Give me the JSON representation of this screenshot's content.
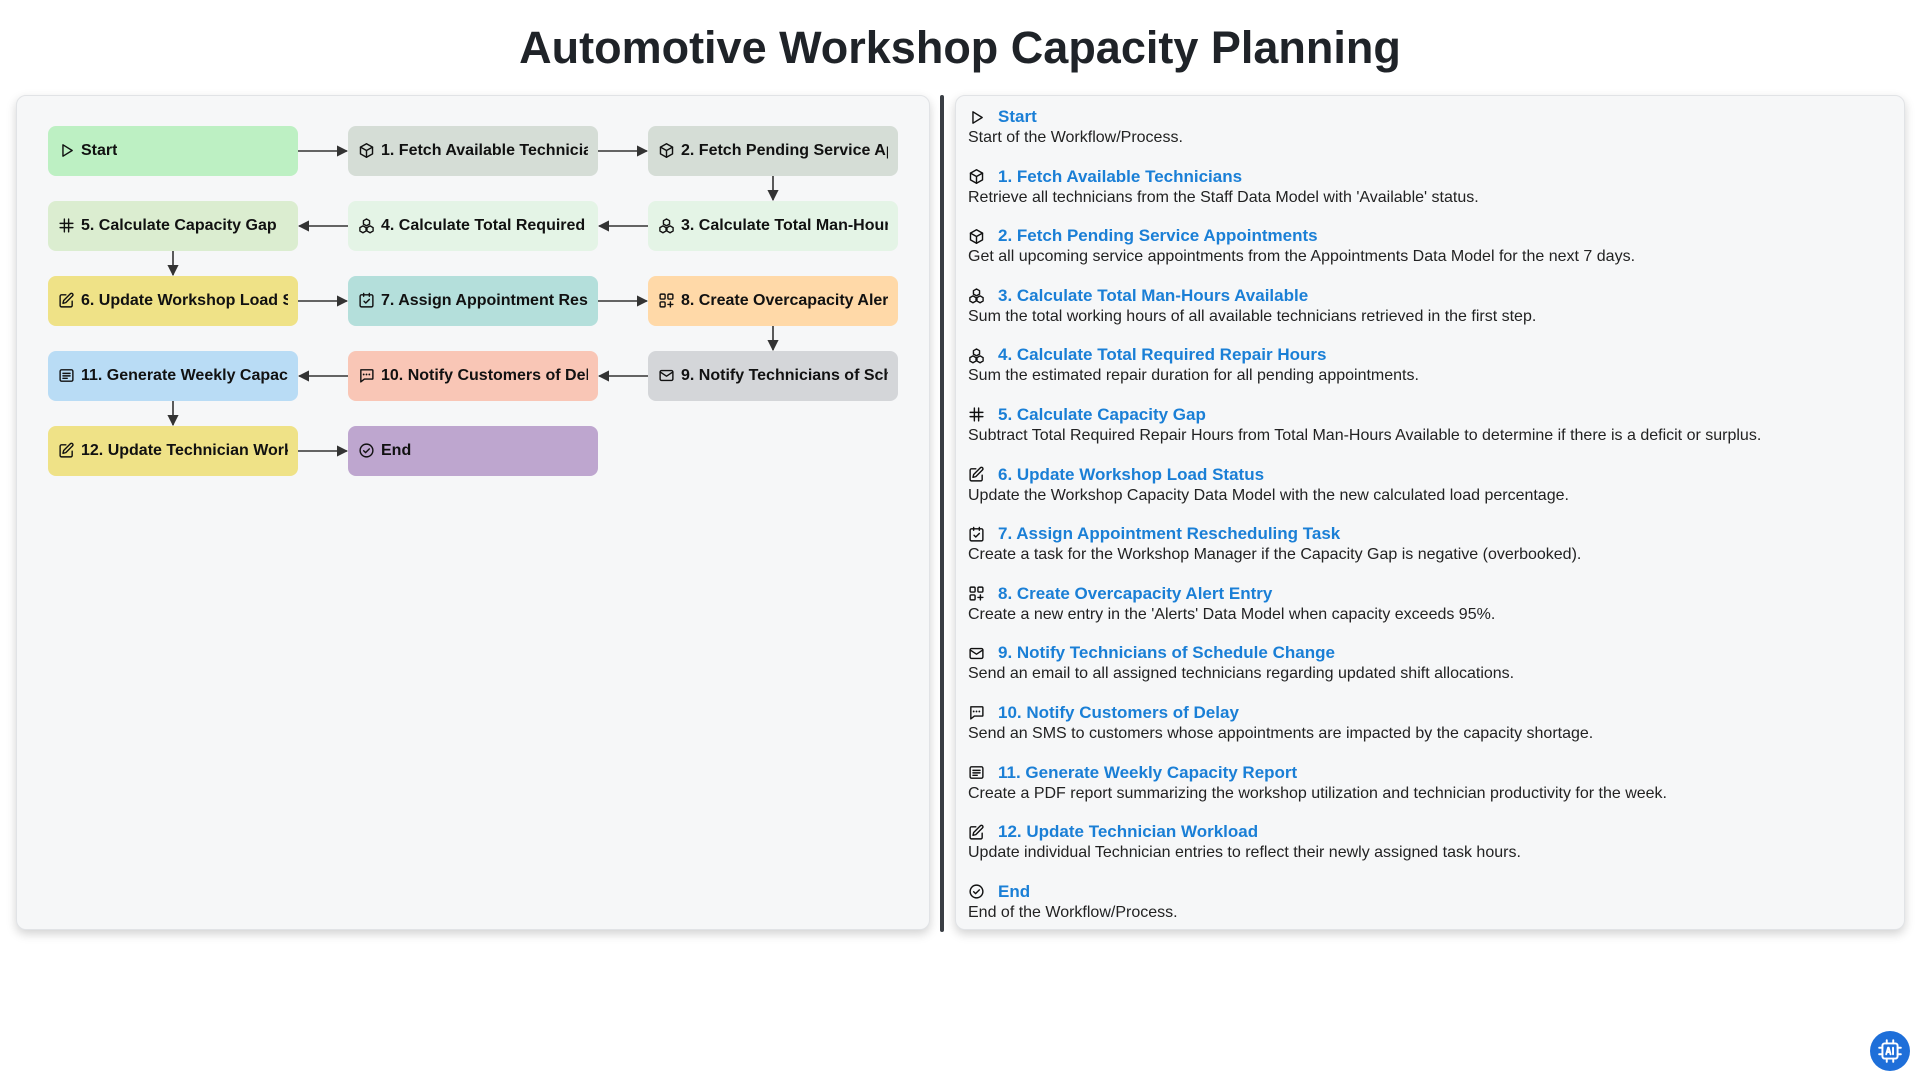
{
  "title": "Automotive Workshop Capacity Planning",
  "colors": {
    "start": "#bdf0c3",
    "fetch": "#d5ddd6",
    "calc": "#e4f4e6",
    "calc_gap": "#dbedd0",
    "update": "#efe287",
    "assign": "#b4dfdb",
    "alert": "#ffd9a8",
    "notify_tech": "#d4d6d9",
    "notify_cust": "#f9c6b6",
    "report": "#b9dcf5",
    "end": "#bea6cf",
    "link": "#1a7fd6"
  },
  "nodes": [
    {
      "id": "start",
      "label": "Start",
      "icon": "play-icon",
      "color": "#bdf0c3"
    },
    {
      "id": "n1",
      "label": "1. Fetch Available Technicians",
      "icon": "cube-icon",
      "color": "#d5ddd6"
    },
    {
      "id": "n2",
      "label": "2. Fetch Pending Service Appointments",
      "icon": "cube-icon",
      "color": "#d5ddd6"
    },
    {
      "id": "n3",
      "label": "3. Calculate Total Man-Hours Available",
      "icon": "cluster-icon",
      "color": "#e4f4e6"
    },
    {
      "id": "n4",
      "label": "4. Calculate Total Required Repair Hours",
      "icon": "cluster-icon",
      "color": "#e4f4e6"
    },
    {
      "id": "n5",
      "label": "5. Calculate Capacity Gap",
      "icon": "hash-icon",
      "color": "#dbedd0"
    },
    {
      "id": "n6",
      "label": "6. Update Workshop Load Status",
      "icon": "edit-icon",
      "color": "#efe287"
    },
    {
      "id": "n7",
      "label": "7. Assign Appointment Rescheduling Task",
      "icon": "check-square-icon",
      "color": "#b4dfdb"
    },
    {
      "id": "n8",
      "label": "8. Create Overcapacity Alert Entry",
      "icon": "grid-plus-icon",
      "color": "#ffd9a8"
    },
    {
      "id": "n9",
      "label": "9. Notify Technicians of Schedule Change",
      "icon": "mail-icon",
      "color": "#d4d6d9"
    },
    {
      "id": "n10",
      "label": "10. Notify Customers of Delay",
      "icon": "sms-icon",
      "color": "#f9c6b6"
    },
    {
      "id": "n11",
      "label": "11. Generate Weekly Capacity Report",
      "icon": "report-icon",
      "color": "#b9dcf5"
    },
    {
      "id": "n12",
      "label": "12. Update Technician Workload",
      "icon": "edit-icon",
      "color": "#efe287"
    },
    {
      "id": "end",
      "label": "End",
      "icon": "check-circle-icon",
      "color": "#bea6cf"
    }
  ],
  "steps": [
    {
      "title": "Start",
      "icon": "play-icon",
      "desc": "Start of the Workflow/Process."
    },
    {
      "title": "1. Fetch Available Technicians",
      "icon": "cube-icon",
      "desc": "Retrieve all technicians from the Staff Data Model with 'Available' status."
    },
    {
      "title": "2. Fetch Pending Service Appointments",
      "icon": "cube-icon",
      "desc": "Get all upcoming service appointments from the Appointments Data Model for the next 7 days."
    },
    {
      "title": "3. Calculate Total Man-Hours Available",
      "icon": "cluster-icon",
      "desc": "Sum the total working hours of all available technicians retrieved in the first step."
    },
    {
      "title": "4. Calculate Total Required Repair Hours",
      "icon": "cluster-icon",
      "desc": "Sum the estimated repair duration for all pending appointments."
    },
    {
      "title": "5. Calculate Capacity Gap",
      "icon": "hash-icon",
      "desc": "Subtract Total Required Repair Hours from Total Man-Hours Available to determine if there is a deficit or surplus."
    },
    {
      "title": "6. Update Workshop Load Status",
      "icon": "edit-icon",
      "desc": "Update the Workshop Capacity Data Model with the new calculated load percentage."
    },
    {
      "title": "7. Assign Appointment Rescheduling Task",
      "icon": "check-square-icon",
      "desc": "Create a task for the Workshop Manager if the Capacity Gap is negative (overbooked)."
    },
    {
      "title": "8. Create Overcapacity Alert Entry",
      "icon": "grid-plus-icon",
      "desc": "Create a new entry in the 'Alerts' Data Model when capacity exceeds 95%."
    },
    {
      "title": "9. Notify Technicians of Schedule Change",
      "icon": "mail-icon",
      "desc": "Send an email to all assigned technicians regarding updated shift allocations."
    },
    {
      "title": "10. Notify Customers of Delay",
      "icon": "sms-icon",
      "desc": "Send an SMS to customers whose appointments are impacted by the capacity shortage."
    },
    {
      "title": "11. Generate Weekly Capacity Report",
      "icon": "report-icon",
      "desc": "Create a PDF report summarizing the workshop utilization and technician productivity for the week."
    },
    {
      "title": "12. Update Technician Workload",
      "icon": "edit-icon",
      "desc": "Update individual Technician entries to reflect their newly assigned task hours."
    },
    {
      "title": "End",
      "icon": "check-circle-icon",
      "desc": "End of the Workflow/Process."
    }
  ],
  "badge": {
    "icon": "ai-chip-icon"
  }
}
